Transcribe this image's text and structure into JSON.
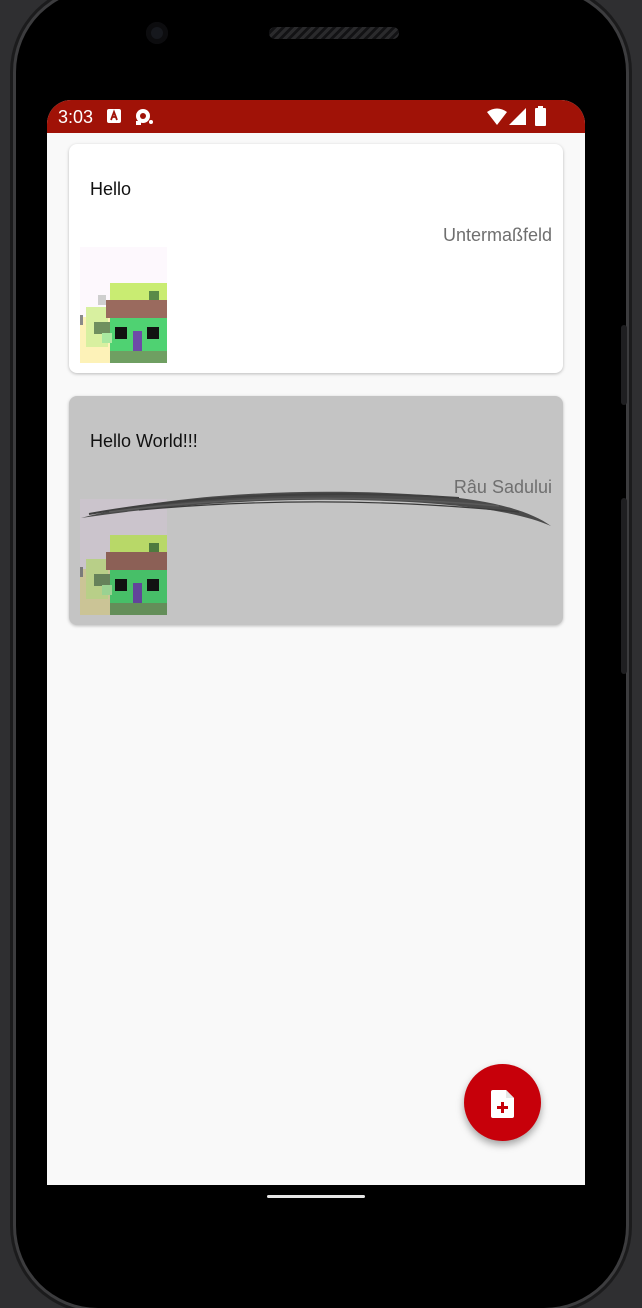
{
  "status_bar": {
    "time": "3:03",
    "icons": [
      "notification-a-icon",
      "assistant-icon",
      "wifi-icon",
      "signal-icon",
      "battery-icon"
    ],
    "background": "#a01207"
  },
  "cards": [
    {
      "title": "Hello",
      "location": "Untermaßfeld",
      "background": "#ffffff",
      "has_strikethrough_stroke": false
    },
    {
      "title": "Hello World!!!",
      "location": "Râu Sadului",
      "background": "#c4c4c4",
      "has_strikethrough_stroke": true
    }
  ],
  "fab": {
    "icon": "add-document-icon",
    "color": "#c7000a"
  },
  "colors": {
    "accent": "#c7000a",
    "status_bar": "#a01207",
    "screen_background": "#f9f9f9"
  }
}
